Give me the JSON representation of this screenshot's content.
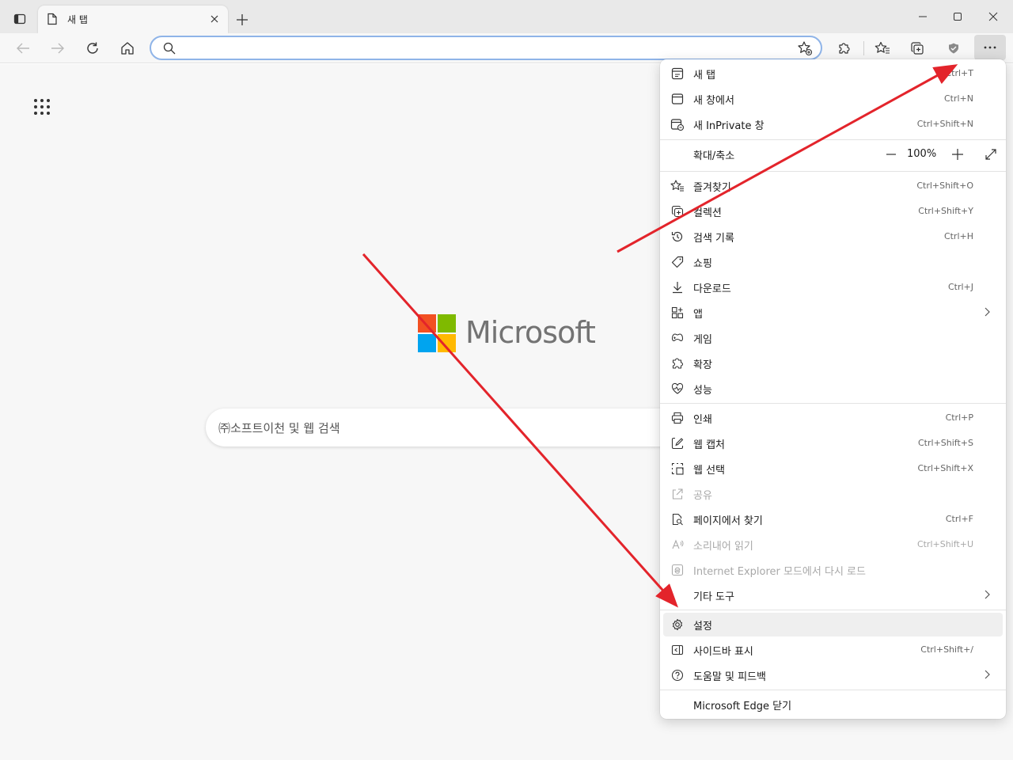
{
  "window": {
    "tab_title": "새 탭"
  },
  "toolbar": {
    "address_value": "",
    "address_placeholder": ""
  },
  "page": {
    "brand_wordmark": "Microsoft",
    "search_placeholder": "㈜소프트이천 및 웹 검색"
  },
  "menu": {
    "new_tab": {
      "label": "새 탭",
      "shortcut": "Ctrl+T"
    },
    "new_window": {
      "label": "새 창에서",
      "shortcut": "Ctrl+N"
    },
    "new_inprivate": {
      "label": "새 InPrivate 창",
      "shortcut": "Ctrl+Shift+N"
    },
    "zoom": {
      "label": "확대/축소",
      "value": "100%"
    },
    "favorites": {
      "label": "즐겨찾기",
      "shortcut": "Ctrl+Shift+O"
    },
    "collections": {
      "label": "컬렉션",
      "shortcut": "Ctrl+Shift+Y"
    },
    "history": {
      "label": "검색 기록",
      "shortcut": "Ctrl+H"
    },
    "shopping": {
      "label": "쇼핑"
    },
    "downloads": {
      "label": "다운로드",
      "shortcut": "Ctrl+J"
    },
    "apps": {
      "label": "앱"
    },
    "games": {
      "label": "게임"
    },
    "extensions": {
      "label": "확장"
    },
    "performance": {
      "label": "성능"
    },
    "print": {
      "label": "인쇄",
      "shortcut": "Ctrl+P"
    },
    "web_capture": {
      "label": "웹 캡처",
      "shortcut": "Ctrl+Shift+S"
    },
    "web_select": {
      "label": "웹 선택",
      "shortcut": "Ctrl+Shift+X"
    },
    "share": {
      "label": "공유"
    },
    "find": {
      "label": "페이지에서 찾기",
      "shortcut": "Ctrl+F"
    },
    "read_aloud": {
      "label": "소리내어 읽기",
      "shortcut": "Ctrl+Shift+U"
    },
    "ie_mode": {
      "label": "Internet Explorer 모드에서 다시 로드"
    },
    "more_tools": {
      "label": "기타 도구"
    },
    "settings": {
      "label": "설정"
    },
    "sidebar": {
      "label": "사이드바 표시",
      "shortcut": "Ctrl+Shift+/"
    },
    "help": {
      "label": "도움말 및 피드백"
    },
    "close_edge": {
      "label": "Microsoft Edge 닫기"
    }
  },
  "colors": {
    "annotation_arrow": "#e3242b",
    "logo_red": "#f25022",
    "logo_green": "#7fba00",
    "logo_blue": "#00a4ef",
    "logo_yellow": "#ffb900"
  }
}
